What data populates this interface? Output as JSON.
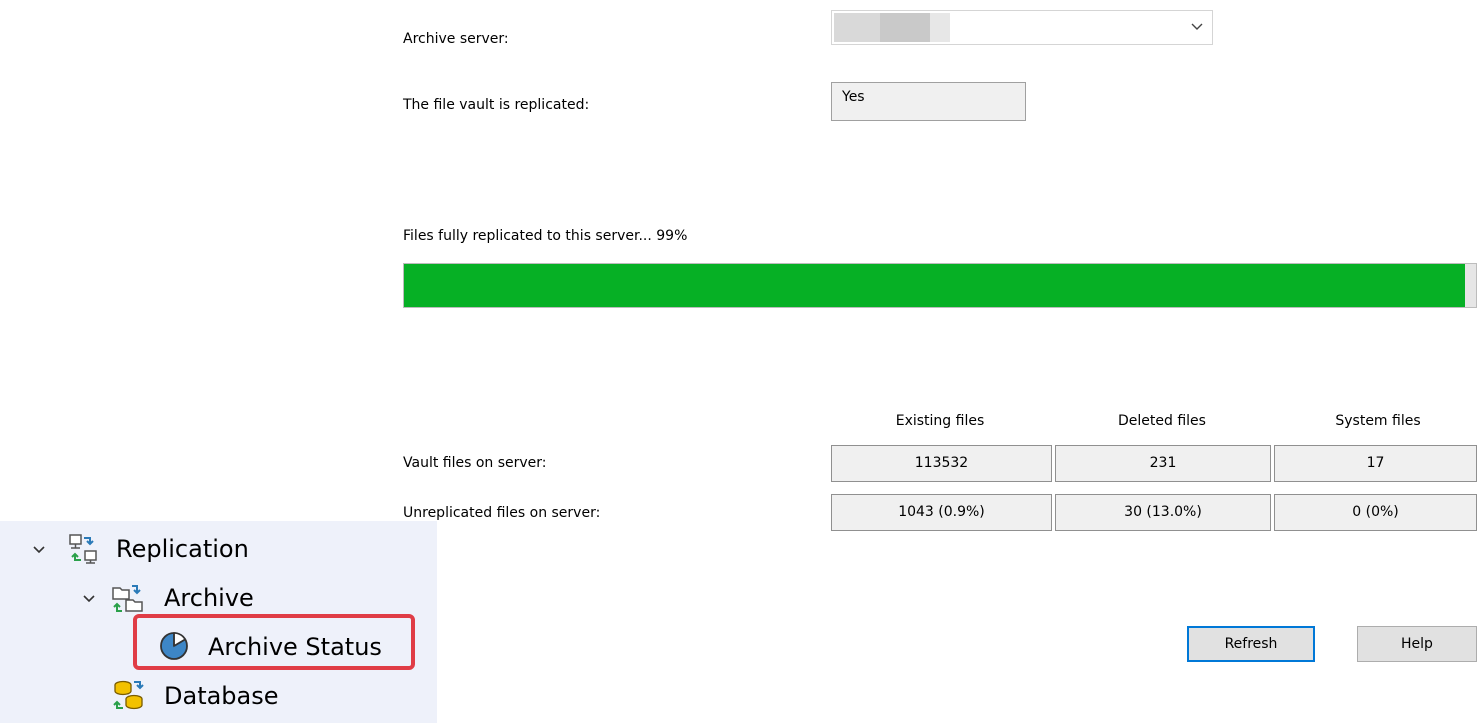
{
  "form": {
    "archive_server_label": "Archive server:",
    "archive_server_value": "",
    "replicated_label": "The file vault is replicated:",
    "replicated_value": "Yes"
  },
  "progress": {
    "label": "Files fully replicated to this server... 99%",
    "percent": 99,
    "fill_color": "#06b025"
  },
  "table": {
    "columns": [
      "Existing files",
      "Deleted files",
      "System files"
    ],
    "rows": [
      {
        "label": "Vault files on server:",
        "values": [
          "113532",
          "231",
          "17"
        ]
      },
      {
        "label": "Unreplicated files on server:",
        "values": [
          "1043 (0.9%)",
          "30 (13.0%)",
          "0 (0%)"
        ]
      }
    ]
  },
  "buttons": {
    "refresh": "Refresh",
    "help": "Help"
  },
  "tree": {
    "replication": "Replication",
    "archive": "Archive",
    "archive_status": "Archive Status",
    "database": "Database",
    "highlight_color": "#e03c46"
  },
  "icons": {
    "dropdown": "chevron-down-icon",
    "replication": "replication-network-icon",
    "archive": "archive-folder-sync-icon",
    "archive_status": "pie-chart-status-icon",
    "database": "database-sync-icon"
  }
}
